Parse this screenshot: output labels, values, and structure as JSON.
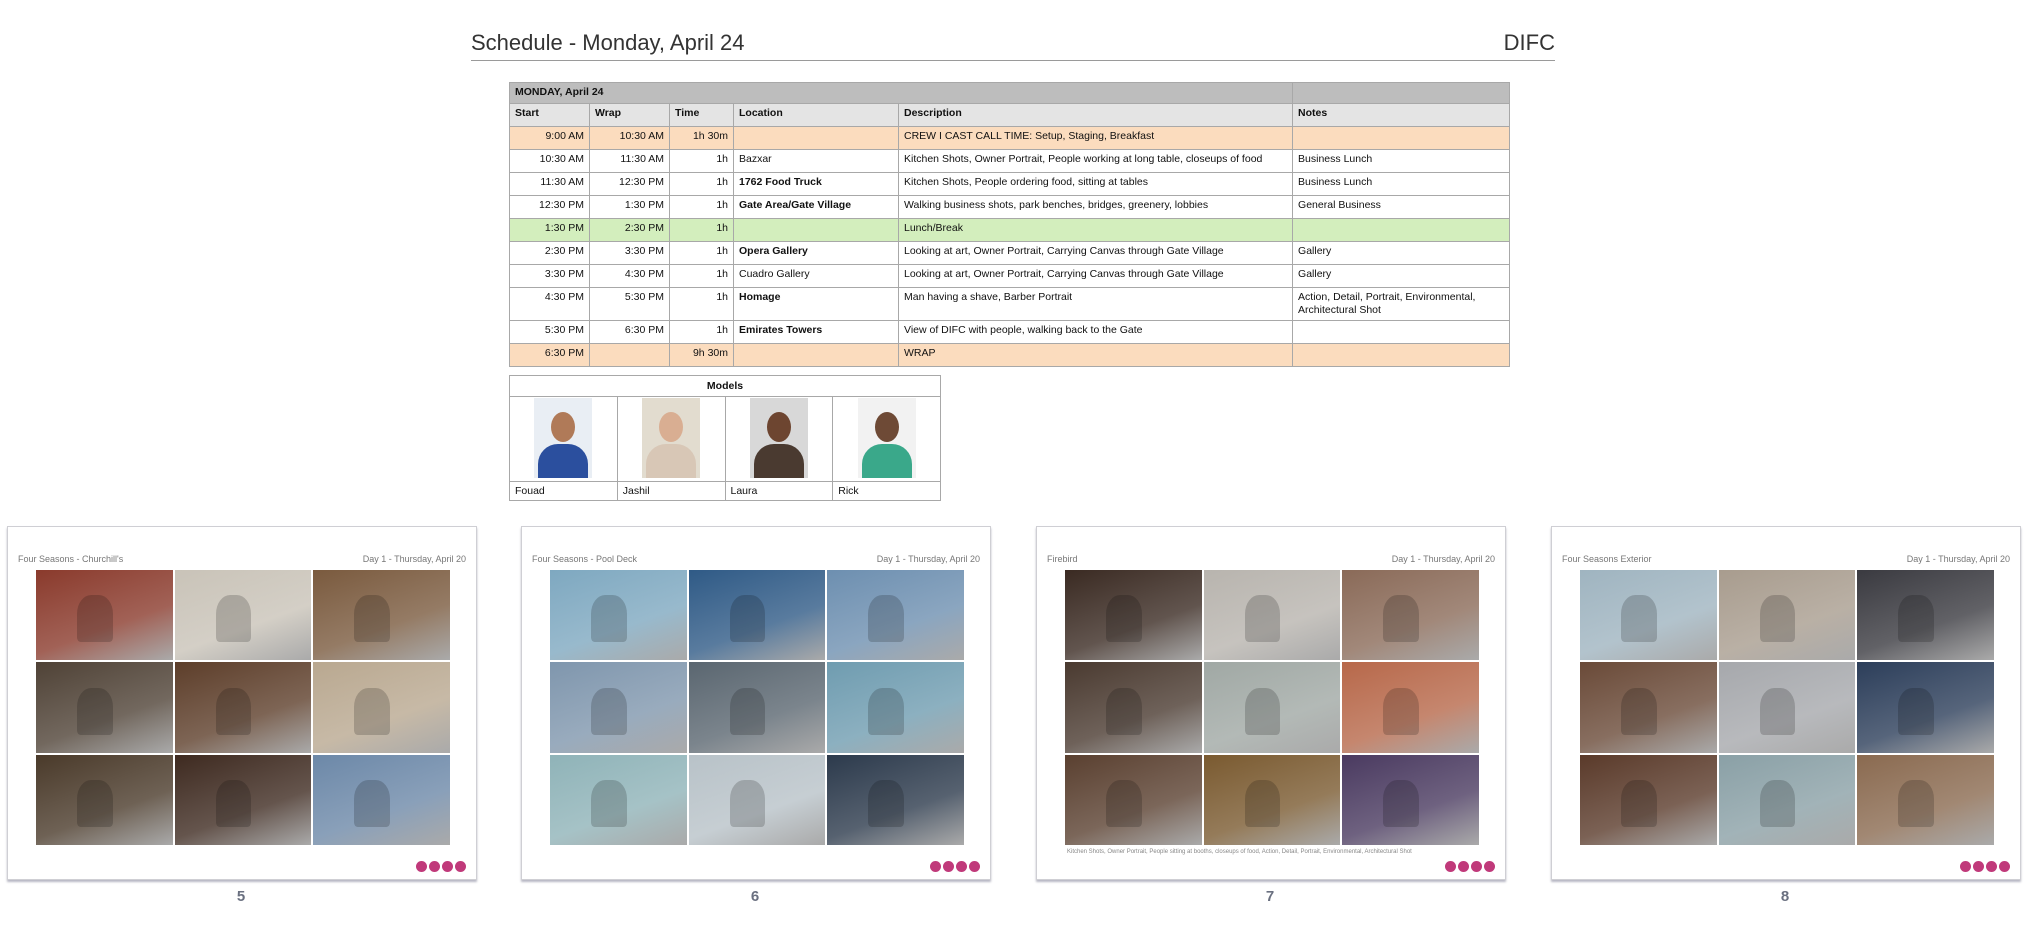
{
  "header": {
    "title": "Schedule - Monday, April 24",
    "site": "DIFC"
  },
  "schedule": {
    "day_label": "MONDAY, April 24",
    "columns": {
      "start": "Start",
      "wrap": "Wrap",
      "time": "Time",
      "location": "Location",
      "description": "Description",
      "notes": "Notes"
    },
    "rows": [
      {
        "start": "9:00 AM",
        "wrap": "10:30 AM",
        "time": "1h 30m",
        "location": "",
        "description": "CREW I CAST CALL TIME: Setup, Staging, Breakfast",
        "notes": ""
      },
      {
        "start": "10:30 AM",
        "wrap": "11:30 AM",
        "time": "1h",
        "location": "Bazxar",
        "description": "Kitchen Shots, Owner Portrait, People working at long table, closeups of food",
        "notes": "Business Lunch"
      },
      {
        "start": "11:30 AM",
        "wrap": "12:30 PM",
        "time": "1h",
        "location": "1762 Food Truck",
        "description": "Kitchen Shots, People ordering food, sitting at tables",
        "notes": "Business Lunch"
      },
      {
        "start": "12:30 PM",
        "wrap": "1:30 PM",
        "time": "1h",
        "location": "Gate Area/Gate Village",
        "description": "Walking business shots, park benches, bridges, greenery, lobbies",
        "notes": "General Business"
      },
      {
        "start": "1:30 PM",
        "wrap": "2:30 PM",
        "time": "1h",
        "location": "",
        "description": "Lunch/Break",
        "notes": ""
      },
      {
        "start": "2:30 PM",
        "wrap": "3:30 PM",
        "time": "1h",
        "location": "Opera Gallery",
        "description": "Looking at art, Owner Portrait, Carrying Canvas through Gate Village",
        "notes": "Gallery"
      },
      {
        "start": "3:30 PM",
        "wrap": "4:30 PM",
        "time": "1h",
        "location": "Cuadro Gallery",
        "description": "Looking at art, Owner Portrait, Carrying Canvas through Gate Village",
        "notes": "Gallery"
      },
      {
        "start": "4:30 PM",
        "wrap": "5:30 PM",
        "time": "1h",
        "location": "Homage",
        "description": "Man having a shave, Barber Portrait",
        "notes": "Action, Detail, Portrait, Environmental, Architectural Shot"
      },
      {
        "start": "5:30 PM",
        "wrap": "6:30 PM",
        "time": "1h",
        "location": "Emirates Towers",
        "description": "View of DIFC with people, walking back to the Gate",
        "notes": ""
      },
      {
        "start": "6:30 PM",
        "wrap": "",
        "time": "9h 30m",
        "location": "",
        "description": "WRAP",
        "notes": ""
      }
    ]
  },
  "models": {
    "title": "Models",
    "people": [
      {
        "name": "Fouad",
        "skin": "#b07a58",
        "shirt": "#2b4f9e",
        "bg": "#e9eef4"
      },
      {
        "name": "Jashil",
        "skin": "#d9ae92",
        "shirt": "#d8c7b6",
        "bg": "#e2dccf"
      },
      {
        "name": "Laura",
        "skin": "#6d4530",
        "shirt": "#4a3a30",
        "bg": "#d8d8d8"
      },
      {
        "name": "Rick",
        "skin": "#6e4a36",
        "shirt": "#3aa88a",
        "bg": "#f2f2f2"
      }
    ]
  },
  "slides": [
    {
      "title": "Four Seasons - Churchill's",
      "date": "Day 1 - Thursday, April 20",
      "page": "5",
      "caption": "",
      "tiles": [
        "#8a3a2c",
        "#c9c3b8",
        "#7a5a3e",
        "#4f4236",
        "#5d3e2a",
        "#b9a890",
        "#4a3a2a",
        "#3e2a20",
        "#6c88a8"
      ]
    },
    {
      "title": "Four Seasons - Pool Deck",
      "date": "Day 1 - Thursday, April 20",
      "page": "6",
      "caption": "",
      "tiles": [
        "#7ea8c0",
        "#2f5a86",
        "#6d8fb0",
        "#7f96ad",
        "#5a6670",
        "#6f9cb0",
        "#8fb3b8",
        "#b8c2c8",
        "#2c3a4c"
      ]
    },
    {
      "title": "Firebird",
      "date": "Day 1 - Thursday, April 20",
      "page": "7",
      "caption": "Kitchen Shots, Owner Portrait, People sitting at booths, closeups of food, Action, Detail, Portrait, Environmental, Architectural Shot",
      "tiles": [
        "#3a2a22",
        "#b8b4ae",
        "#8a6a58",
        "#4a3a30",
        "#a0a8a4",
        "#b7684a",
        "#5a4030",
        "#7a5a30",
        "#4a3a60"
      ]
    },
    {
      "title": "Four Seasons Exterior",
      "date": "Day 1 - Thursday, April 20",
      "page": "8",
      "caption": "",
      "tiles": [
        "#9fb4c0",
        "#a89c8e",
        "#3a3a40",
        "#6a4a38",
        "#a6a8ac",
        "#2c3e5a",
        "#5a3a2a",
        "#8aa0a6",
        "#8a6a50"
      ]
    }
  ]
}
